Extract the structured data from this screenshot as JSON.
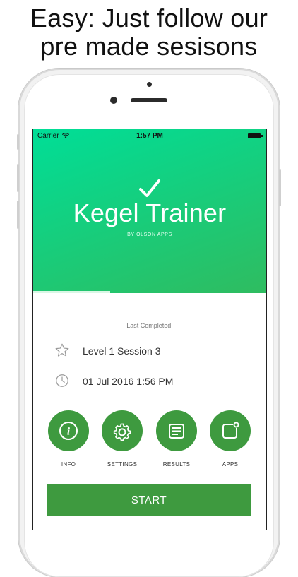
{
  "headline": {
    "line1": "Easy: Just follow our",
    "line2": "pre made sesisons"
  },
  "status_bar": {
    "carrier": "Carrier",
    "time": "1:57 PM"
  },
  "app": {
    "title": "Kegel Trainer",
    "byline": "BY OLSON APPS"
  },
  "hero_progress": 0.33,
  "last_completed": {
    "label": "Last Completed:",
    "session": "Level 1 Session 3",
    "datetime": "01 Jul 2016 1:56 PM"
  },
  "actions": [
    {
      "label": "INFO",
      "icon": "info-icon"
    },
    {
      "label": "SETTINGS",
      "icon": "gear-icon"
    },
    {
      "label": "RESULTS",
      "icon": "results-icon"
    },
    {
      "label": "APPS",
      "icon": "apps-icon"
    }
  ],
  "start_label": "START",
  "colors": {
    "gradient_start": "#00de97",
    "gradient_end": "#2fbc60",
    "button_green": "#3e9a3f"
  }
}
